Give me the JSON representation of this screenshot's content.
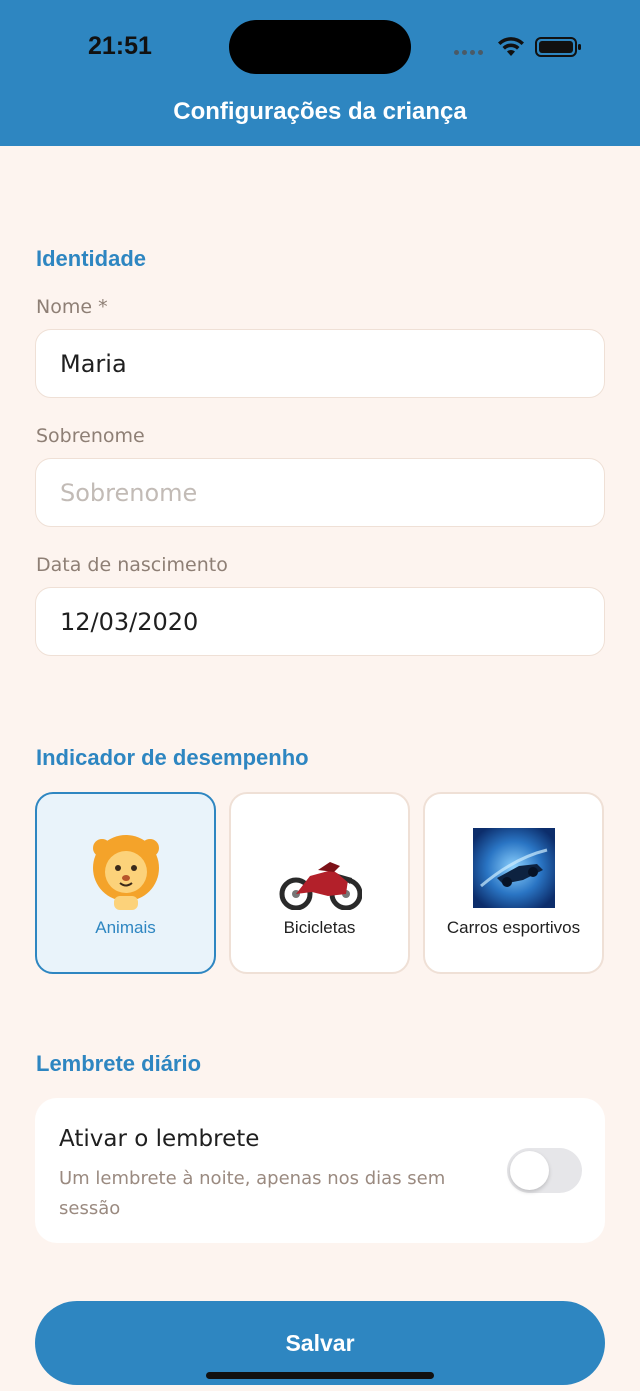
{
  "status_bar": {
    "time": "21:51"
  },
  "header": {
    "title": "Configurações da criança"
  },
  "identity": {
    "section_title": "Identidade",
    "first_name": {
      "label": "Nome *",
      "value": "Maria"
    },
    "last_name": {
      "label": "Sobrenome",
      "placeholder": "Sobrenome",
      "value": ""
    },
    "birth_date": {
      "label": "Data de nascimento",
      "value": "12/03/2020"
    }
  },
  "performance": {
    "section_title": "Indicador de desempenho",
    "options": [
      {
        "label": "Animais",
        "icon": "lion-icon",
        "selected": true
      },
      {
        "label": "Bicicletas",
        "icon": "motorcycle-icon",
        "selected": false
      },
      {
        "label": "Carros esportivos",
        "icon": "sports-car-icon",
        "selected": false
      }
    ]
  },
  "reminder": {
    "section_title": "Lembrete diário",
    "title": "Ativar o lembrete",
    "description": "Um lembrete à noite, apenas nos dias sem sessão",
    "enabled": false
  },
  "actions": {
    "save_label": "Salvar"
  },
  "colors": {
    "accent": "#2e86c1",
    "background": "#fdf4ef",
    "card_border": "#efe0d6",
    "muted_text": "#8e7f75"
  }
}
